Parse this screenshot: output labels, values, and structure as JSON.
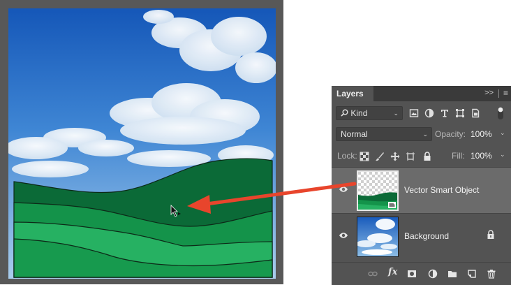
{
  "panel": {
    "tab_title": "Layers",
    "collapse_glyph": ">>",
    "menu_glyph": "≡"
  },
  "filter": {
    "kind_label": "Kind",
    "kind_icon": "search-icon",
    "filter_icons": [
      "pixel-layer-filter-icon",
      "adjustment-layer-filter-icon",
      "type-layer-filter-icon",
      "shape-layer-filter-icon",
      "smart-object-filter-icon",
      "filter-toggle-icon"
    ]
  },
  "blend": {
    "mode": "Normal",
    "opacity_label": "Opacity:",
    "opacity_value": "100%"
  },
  "lock": {
    "label": "Lock:",
    "icons": [
      "lock-transparent-pixels-icon",
      "lock-image-pixels-icon",
      "lock-position-icon",
      "lock-artboard-icon",
      "lock-all-icon"
    ],
    "fill_label": "Fill:",
    "fill_value": "100%"
  },
  "layers": [
    {
      "name": "Vector Smart Object",
      "visible": true,
      "selected": true,
      "locked": false
    },
    {
      "name": "Background",
      "visible": true,
      "selected": false,
      "locked": true
    }
  ],
  "bottom_bar": {
    "icons": [
      "link-layers-icon",
      "fx-icon",
      "add-mask-icon",
      "new-fill-adjustment-icon",
      "new-group-icon",
      "new-layer-icon",
      "delete-layer-icon"
    ],
    "fx_label": "fx"
  },
  "colors": {
    "panel_bg": "#535353",
    "selected_row": "#6b6b6b",
    "annotation_arrow": "#e8452c",
    "hill_dark": "#0b6a37",
    "hill_mid": "#14934a",
    "hill_light": "#26b162",
    "hill_front": "#179a4e"
  }
}
